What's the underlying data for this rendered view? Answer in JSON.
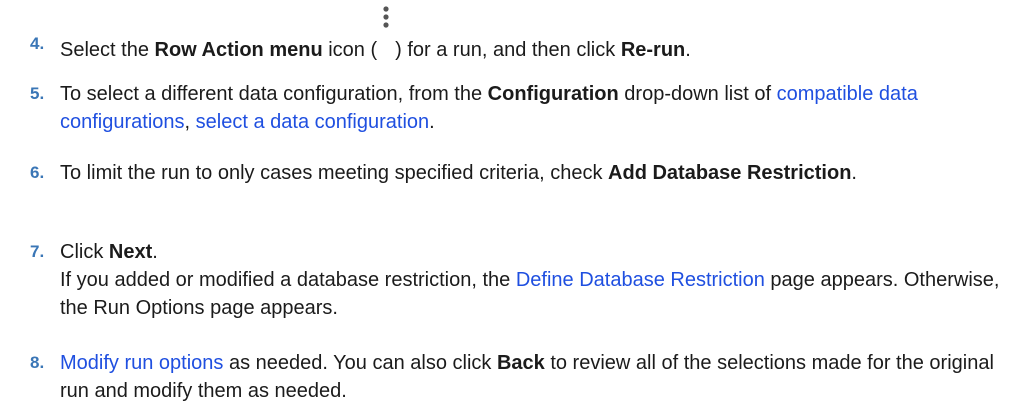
{
  "steps": [
    {
      "number": "4.",
      "t1": "Select the ",
      "b1": "Row Action menu",
      "t2": " icon (",
      "icon": "vertical-ellipsis-icon",
      "t3": ") for a run, and then click ",
      "b2": "Re-run",
      "t4": "."
    },
    {
      "number": "5.",
      "t1": "To select a different data configuration, from the ",
      "b1": "Configuration",
      "t2": " drop-down list of ",
      "link1": "compatible data configurations",
      "t3": ", ",
      "link2": "select a data configuration",
      "t4": "."
    },
    {
      "number": "6.",
      "t1": "To limit the run to only cases meeting specified criteria, check ",
      "b1": "Add Database Restriction",
      "t2": "."
    },
    {
      "number": "7.",
      "t1": "Click ",
      "b1": "Next",
      "t2": ".",
      "t3": "If you added or modified a database restriction, the ",
      "link1": "Define Database Restriction",
      "t4": " page appears. Otherwise, the Run Options page appears."
    },
    {
      "number": "8.",
      "link1": "Modify run options",
      "t1": " as needed. You can also click ",
      "b1": "Back",
      "t2": " to review all of the selections made for the original run and modify them as needed."
    }
  ],
  "colors": {
    "number": "#3a76b6",
    "link": "#1f4fe0",
    "text": "#1b1b1b"
  }
}
